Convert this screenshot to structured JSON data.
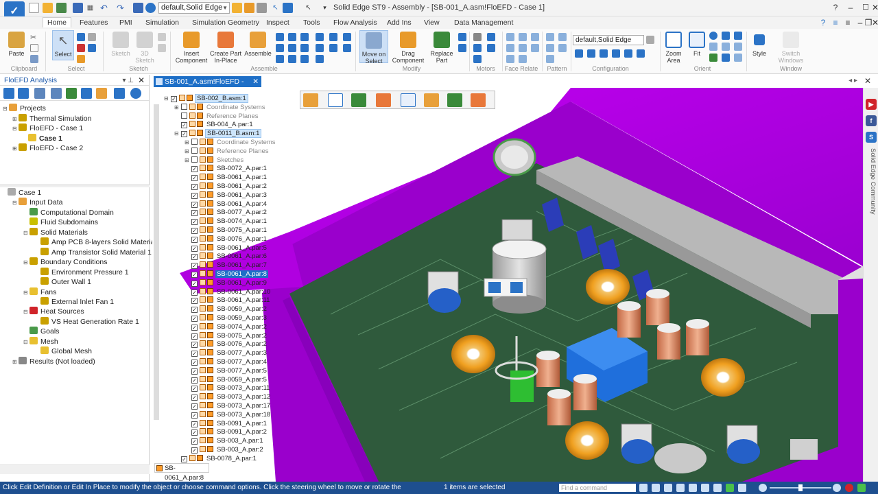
{
  "app": {
    "window_title": "Solid Edge ST9 - Assembly - [SB-001_A.asm!FloEFD - Case 1]",
    "config_value": "default,Solid Edge",
    "logo_char": "✓"
  },
  "ribbon_tabs": [
    "Home",
    "Features",
    "PMI",
    "Simulation",
    "Simulation Geometry",
    "Inspect",
    "Tools",
    "Flow Analysis",
    "Add Ins",
    "View",
    "Data Management"
  ],
  "ribbon": {
    "paste": "Paste",
    "select": "Select",
    "sketch": "Sketch",
    "sketch3d": "3D Sketch",
    "insert_component": "Insert Component",
    "create_part_in_place": "Create Part In-Place",
    "assemble": "Assemble",
    "move_on_select": "Move on Select",
    "drag_component": "Drag Component",
    "replace_part": "Replace Part",
    "zoom_area": "Zoom Area",
    "fit": "Fit",
    "style": "Style",
    "switch_windows": "Switch Windows",
    "config_value": "default,Solid Edge",
    "groups": {
      "clipboard": "Clipboard",
      "select": "Select",
      "sketch": "Sketch",
      "assemble": "Assemble",
      "modify": "Modify",
      "motors": "Motors",
      "face_relate": "Face Relate",
      "pattern": "Pattern",
      "configuration": "Configuration",
      "orient": "Orient",
      "window": "Window"
    }
  },
  "left_panel": {
    "title": "FloEFD Analysis",
    "projects_tree": [
      {
        "label": "Projects",
        "indent": 0,
        "exp": "⊟"
      },
      {
        "label": "Thermal Simulation",
        "indent": 1,
        "exp": "⊞"
      },
      {
        "label": "FloEFD - Case 1",
        "indent": 1,
        "exp": "⊟"
      },
      {
        "label": "Case 1",
        "indent": 2,
        "exp": "",
        "selected": true
      },
      {
        "label": "FloEFD - Case 2",
        "indent": 1,
        "exp": "⊞"
      }
    ],
    "analysis_tree": [
      {
        "label": "Case 1",
        "indent": 0,
        "exp": ""
      },
      {
        "label": "Input Data",
        "indent": 1,
        "exp": "⊟"
      },
      {
        "label": "Computational Domain",
        "indent": 2,
        "exp": ""
      },
      {
        "label": "Fluid Subdomains",
        "indent": 2,
        "exp": ""
      },
      {
        "label": "Solid Materials",
        "indent": 2,
        "exp": "⊟"
      },
      {
        "label": "Amp PCB 8-layers Solid Material 1",
        "indent": 3,
        "exp": ""
      },
      {
        "label": "Amp Transistor Solid Material 1",
        "indent": 3,
        "exp": ""
      },
      {
        "label": "Boundary Conditions",
        "indent": 2,
        "exp": "⊟"
      },
      {
        "label": "Environment Pressure 1",
        "indent": 3,
        "exp": ""
      },
      {
        "label": "Outer Wall 1",
        "indent": 3,
        "exp": ""
      },
      {
        "label": "Fans",
        "indent": 2,
        "exp": "⊟"
      },
      {
        "label": "External Inlet Fan 1",
        "indent": 3,
        "exp": ""
      },
      {
        "label": "Heat Sources",
        "indent": 2,
        "exp": "⊟"
      },
      {
        "label": "VS Heat Generation Rate 1",
        "indent": 3,
        "exp": ""
      },
      {
        "label": "Goals",
        "indent": 2,
        "exp": ""
      },
      {
        "label": "Mesh",
        "indent": 2,
        "exp": "⊟"
      },
      {
        "label": "Global Mesh",
        "indent": 3,
        "exp": ""
      },
      {
        "label": "Results (Not loaded)",
        "indent": 1,
        "exp": "⊞"
      }
    ]
  },
  "document_tab": "SB-001_A.asm!FloEFD - Case 1",
  "model_tree": [
    {
      "label": "SB-002_B.asm:1",
      "indent": 2,
      "cb": "✓",
      "exp": "⊟",
      "style": "hl"
    },
    {
      "label": "Coordinate Systems",
      "indent": 3,
      "cb": "",
      "exp": "⊞",
      "style": "dim"
    },
    {
      "label": "Reference Planes",
      "indent": 3,
      "cb": "",
      "exp": "",
      "style": "dim"
    },
    {
      "label": "SB-004_A.par:1",
      "indent": 3,
      "cb": "✓",
      "exp": "",
      "style": ""
    },
    {
      "label": "SB-0011_B.asm:1",
      "indent": 3,
      "cb": "✓",
      "exp": "⊟",
      "style": "hl"
    },
    {
      "label": "Coordinate Systems",
      "indent": 4,
      "cb": "",
      "exp": "⊞",
      "style": "dim"
    },
    {
      "label": "Reference Planes",
      "indent": 4,
      "cb": "",
      "exp": "⊞",
      "style": "dim"
    },
    {
      "label": "Sketches",
      "indent": 4,
      "cb": "",
      "exp": "⊞",
      "style": "dim"
    },
    {
      "label": "SB-0072_A.par:1",
      "indent": 4,
      "cb": "✓",
      "exp": "",
      "style": ""
    },
    {
      "label": "SB-0061_A.par:1",
      "indent": 4,
      "cb": "✓",
      "exp": "",
      "style": ""
    },
    {
      "label": "SB-0061_A.par:2",
      "indent": 4,
      "cb": "✓",
      "exp": "",
      "style": ""
    },
    {
      "label": "SB-0061_A.par:3",
      "indent": 4,
      "cb": "✓",
      "exp": "",
      "style": ""
    },
    {
      "label": "SB-0061_A.par:4",
      "indent": 4,
      "cb": "✓",
      "exp": "",
      "style": ""
    },
    {
      "label": "SB-0077_A.par:2",
      "indent": 4,
      "cb": "✓",
      "exp": "",
      "style": ""
    },
    {
      "label": "SB-0074_A.par:1",
      "indent": 4,
      "cb": "✓",
      "exp": "",
      "style": ""
    },
    {
      "label": "SB-0075_A.par:1",
      "indent": 4,
      "cb": "✓",
      "exp": "",
      "style": ""
    },
    {
      "label": "SB-0076_A.par:1",
      "indent": 4,
      "cb": "✓",
      "exp": "",
      "style": ""
    },
    {
      "label": "SB-0061_A.par:5",
      "indent": 4,
      "cb": "✓",
      "exp": "",
      "style": ""
    },
    {
      "label": "SB-0061_A.par:6",
      "indent": 4,
      "cb": "✓",
      "exp": "",
      "style": ""
    },
    {
      "label": "SB-0061_A.par:7",
      "indent": 4,
      "cb": "✓",
      "exp": "",
      "style": ""
    },
    {
      "label": "SB-0061_A.par:8",
      "indent": 4,
      "cb": "✓",
      "exp": "",
      "style": "sel"
    },
    {
      "label": "SB-0061_A.par:9",
      "indent": 4,
      "cb": "✓",
      "exp": "",
      "style": ""
    },
    {
      "label": "SB-0061_A.par:10",
      "indent": 4,
      "cb": "✓",
      "exp": "",
      "style": ""
    },
    {
      "label": "SB-0061_A.par:11",
      "indent": 4,
      "cb": "✓",
      "exp": "",
      "style": ""
    },
    {
      "label": "SB-0059_A.par:2",
      "indent": 4,
      "cb": "✓",
      "exp": "",
      "style": ""
    },
    {
      "label": "SB-0059_A.par:3",
      "indent": 4,
      "cb": "✓",
      "exp": "",
      "style": ""
    },
    {
      "label": "SB-0074_A.par:2",
      "indent": 4,
      "cb": "✓",
      "exp": "",
      "style": ""
    },
    {
      "label": "SB-0075_A.par:2",
      "indent": 4,
      "cb": "✓",
      "exp": "",
      "style": ""
    },
    {
      "label": "SB-0076_A.par:2",
      "indent": 4,
      "cb": "✓",
      "exp": "",
      "style": ""
    },
    {
      "label": "SB-0077_A.par:3",
      "indent": 4,
      "cb": "✓",
      "exp": "",
      "style": ""
    },
    {
      "label": "SB-0077_A.par:4",
      "indent": 4,
      "cb": "✓",
      "exp": "",
      "style": ""
    },
    {
      "label": "SB-0077_A.par:5",
      "indent": 4,
      "cb": "✓",
      "exp": "",
      "style": ""
    },
    {
      "label": "SB-0059_A.par:5",
      "indent": 4,
      "cb": "✓",
      "exp": "",
      "style": ""
    },
    {
      "label": "SB-0073_A.par:11",
      "indent": 4,
      "cb": "✓",
      "exp": "",
      "style": ""
    },
    {
      "label": "SB-0073_A.par:12",
      "indent": 4,
      "cb": "✓",
      "exp": "",
      "style": ""
    },
    {
      "label": "SB-0073_A.par:17",
      "indent": 4,
      "cb": "✓",
      "exp": "",
      "style": ""
    },
    {
      "label": "SB-0073_A.par:18",
      "indent": 4,
      "cb": "✓",
      "exp": "",
      "style": ""
    },
    {
      "label": "SB-0091_A.par:1",
      "indent": 4,
      "cb": "✓",
      "exp": "",
      "style": ""
    },
    {
      "label": "SB-0091_A.par:2",
      "indent": 4,
      "cb": "✓",
      "exp": "",
      "style": ""
    },
    {
      "label": "SB-003_A.par:1",
      "indent": 4,
      "cb": "✓",
      "exp": "",
      "style": ""
    },
    {
      "label": "SB-003_A.par:2",
      "indent": 4,
      "cb": "✓",
      "exp": "",
      "style": ""
    },
    {
      "label": "SB-0078_A.par:1",
      "indent": 3,
      "cb": "✓",
      "exp": "",
      "style": ""
    }
  ],
  "model_tree_bottom": "SB-0061_A.par:8",
  "right_rail_text": "Solid Edge Community",
  "status": {
    "message": "Click Edit Definition or Edit In Place to modify the object or choose command options. Click the steering wheel to move or rotate the sele",
    "selected": "1 items are selected",
    "command_finder_placeholder": "Find a command"
  },
  "colors": {
    "enclosure_magenta": "#b000e0",
    "pcb_green": "#2f5a3c",
    "accent_blue": "#1e6fc7",
    "statusbar": "#1e4f8f"
  },
  "icons": {
    "logo": "solid-edge-logo",
    "save": "save-icon",
    "undo": "undo-icon",
    "redo": "redo-icon",
    "close": "close-icon",
    "pin": "pin-icon"
  }
}
